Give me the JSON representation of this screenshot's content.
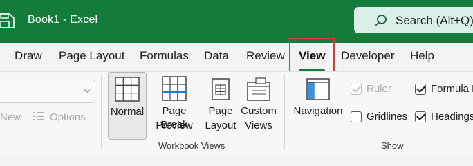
{
  "titlebar": {
    "title": "Book1  -  Excel",
    "search_label": "Search (Alt+Q)",
    "color": "#137c3b"
  },
  "tabs": [
    {
      "label": "Draw"
    },
    {
      "label": "Page Layout"
    },
    {
      "label": "Formulas"
    },
    {
      "label": "Data"
    },
    {
      "label": "Review"
    },
    {
      "label": "View",
      "active": true,
      "highlight_color": "#e03a2f"
    },
    {
      "label": "Developer"
    },
    {
      "label": "Help"
    }
  ],
  "ribbon": {
    "left_group": {
      "new_label": "New",
      "options_label": "Options"
    },
    "workbook_views": {
      "group_label": "Workbook Views",
      "normal_label": "Normal",
      "page_break_label_1": "Page Break",
      "page_break_label_2": "Preview",
      "page_layout_label_1": "Page",
      "page_layout_label_2": "Layout",
      "custom_views_label_1": "Custom",
      "custom_views_label_2": "Views"
    },
    "show": {
      "group_label": "Show",
      "navigation_label": "Navigation",
      "ruler_label": "Ruler",
      "gridlines_label": "Gridlines",
      "formula_bar_label": "Formula B",
      "headings_label": "Headings"
    }
  }
}
